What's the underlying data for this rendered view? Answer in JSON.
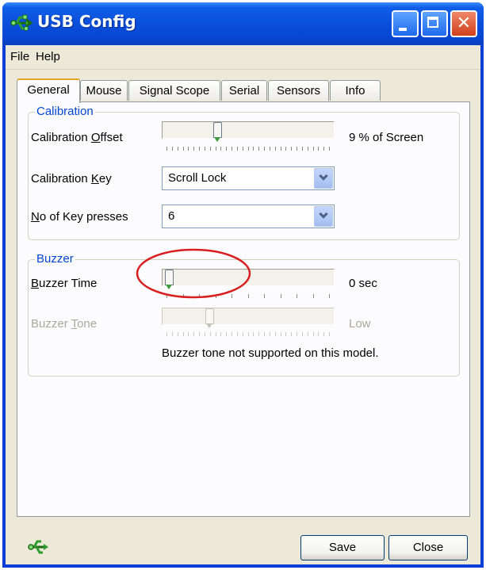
{
  "window": {
    "title": "USB Config"
  },
  "menu": [
    "File",
    "Help"
  ],
  "tabs": [
    "General",
    "Mouse",
    "Signal Scope",
    "Serial",
    "Sensors",
    "Info"
  ],
  "active_tab": "General",
  "calibration": {
    "group_title": "Calibration",
    "offset": {
      "label_pre": "Calibration ",
      "label_key": "O",
      "label_post": "ffset",
      "value_text": "9 % of Screen",
      "slider_fraction": 0.3
    },
    "key": {
      "label_pre": "Calibration ",
      "label_key": "K",
      "label_post": "ey",
      "selected": "Scroll Lock"
    },
    "presses": {
      "label_pre": "",
      "label_key": "N",
      "label_post": "o of Key presses",
      "selected": "6"
    }
  },
  "buzzer": {
    "group_title": "Buzzer",
    "time": {
      "label_pre": "",
      "label_key": "B",
      "label_post": "uzzer Time",
      "value_text": "0 sec",
      "slider_fraction": 0.0
    },
    "tone": {
      "label_pre": "Buzzer ",
      "label_key": "T",
      "label_post": "one",
      "value_text": "Low",
      "slider_fraction": 0.25,
      "enabled": false
    },
    "note": "Buzzer tone not supported on this model."
  },
  "buttons": {
    "save": "Save",
    "close": "Close"
  },
  "colors": {
    "titlebar": "#0a4fdc",
    "group_title": "#0046d5",
    "annotation": "#d81e1e",
    "tab_highlight": "#e6a224"
  },
  "icons": {
    "app": "usb-icon",
    "status": "usb-icon"
  }
}
